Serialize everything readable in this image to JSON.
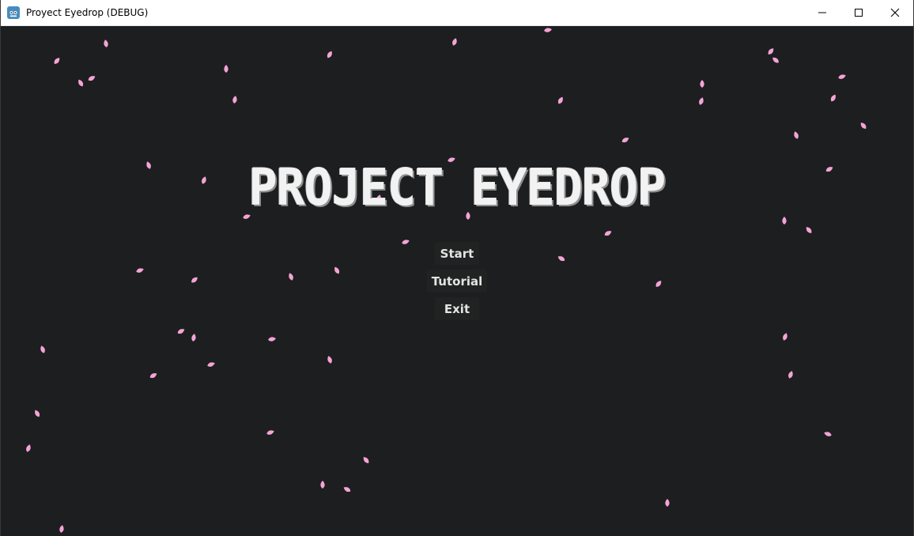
{
  "window": {
    "title": "Proyect Eyedrop (DEBUG)",
    "icons": [
      "godot-app-icon",
      "minimize-icon",
      "maximize-icon",
      "close-icon"
    ]
  },
  "game": {
    "title": "PROJECT EYEDROP",
    "menu": {
      "start_label": "Start",
      "tutorial_label": "Tutorial",
      "exit_label": "Exit"
    },
    "colors": {
      "background": "#1d1e1f",
      "petal": "#f5a3d7",
      "title_text": "#f2f2f2",
      "button_bg": "#212222",
      "button_text": "#e3e3e3"
    }
  }
}
